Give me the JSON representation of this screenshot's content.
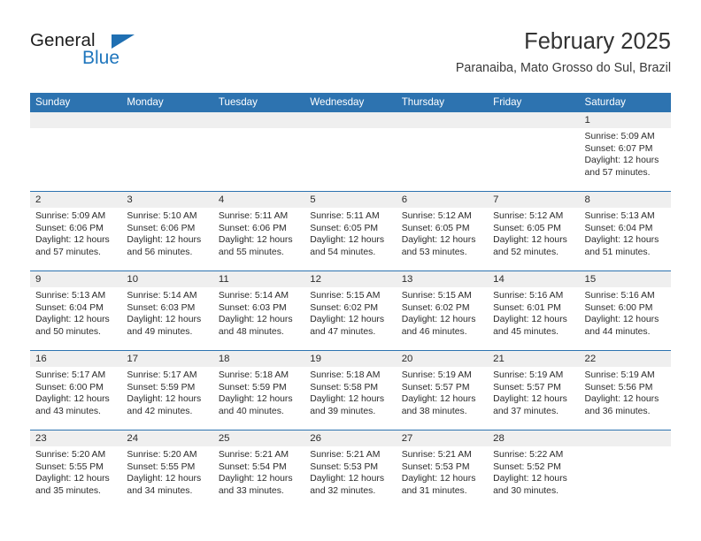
{
  "brand": {
    "name_primary": "General",
    "name_secondary": "Blue",
    "logo_icon": "triangle-icon",
    "accent_color": "#1f76bd"
  },
  "header": {
    "title": "February 2025",
    "location": "Paranaiba, Mato Grosso do Sul, Brazil"
  },
  "colors": {
    "header_blue": "#2d73b0",
    "daynum_band": "#efefef",
    "text": "#2b2b2b"
  },
  "labels": {
    "sunrise": "Sunrise:",
    "sunset": "Sunset:",
    "daylight": "Daylight:"
  },
  "weekday_headers": [
    "Sunday",
    "Monday",
    "Tuesday",
    "Wednesday",
    "Thursday",
    "Friday",
    "Saturday"
  ],
  "weeks": [
    [
      {
        "day": "",
        "lines": []
      },
      {
        "day": "",
        "lines": []
      },
      {
        "day": "",
        "lines": []
      },
      {
        "day": "",
        "lines": []
      },
      {
        "day": "",
        "lines": []
      },
      {
        "day": "",
        "lines": []
      },
      {
        "day": "1",
        "sunrise": "5:09 AM",
        "sunset": "6:07 PM",
        "daylight": "12 hours and 57 minutes.",
        "lines": [
          "Sunrise: 5:09 AM",
          "Sunset: 6:07 PM",
          "Daylight: 12 hours and 57 minutes."
        ]
      }
    ],
    [
      {
        "day": "2",
        "sunrise": "5:09 AM",
        "sunset": "6:06 PM",
        "daylight": "12 hours and 57 minutes.",
        "lines": [
          "Sunrise: 5:09 AM",
          "Sunset: 6:06 PM",
          "Daylight: 12 hours and 57 minutes."
        ]
      },
      {
        "day": "3",
        "sunrise": "5:10 AM",
        "sunset": "6:06 PM",
        "daylight": "12 hours and 56 minutes.",
        "lines": [
          "Sunrise: 5:10 AM",
          "Sunset: 6:06 PM",
          "Daylight: 12 hours and 56 minutes."
        ]
      },
      {
        "day": "4",
        "sunrise": "5:11 AM",
        "sunset": "6:06 PM",
        "daylight": "12 hours and 55 minutes.",
        "lines": [
          "Sunrise: 5:11 AM",
          "Sunset: 6:06 PM",
          "Daylight: 12 hours and 55 minutes."
        ]
      },
      {
        "day": "5",
        "sunrise": "5:11 AM",
        "sunset": "6:05 PM",
        "daylight": "12 hours and 54 minutes.",
        "lines": [
          "Sunrise: 5:11 AM",
          "Sunset: 6:05 PM",
          "Daylight: 12 hours and 54 minutes."
        ]
      },
      {
        "day": "6",
        "sunrise": "5:12 AM",
        "sunset": "6:05 PM",
        "daylight": "12 hours and 53 minutes.",
        "lines": [
          "Sunrise: 5:12 AM",
          "Sunset: 6:05 PM",
          "Daylight: 12 hours and 53 minutes."
        ]
      },
      {
        "day": "7",
        "sunrise": "5:12 AM",
        "sunset": "6:05 PM",
        "daylight": "12 hours and 52 minutes.",
        "lines": [
          "Sunrise: 5:12 AM",
          "Sunset: 6:05 PM",
          "Daylight: 12 hours and 52 minutes."
        ]
      },
      {
        "day": "8",
        "sunrise": "5:13 AM",
        "sunset": "6:04 PM",
        "daylight": "12 hours and 51 minutes.",
        "lines": [
          "Sunrise: 5:13 AM",
          "Sunset: 6:04 PM",
          "Daylight: 12 hours and 51 minutes."
        ]
      }
    ],
    [
      {
        "day": "9",
        "sunrise": "5:13 AM",
        "sunset": "6:04 PM",
        "daylight": "12 hours and 50 minutes.",
        "lines": [
          "Sunrise: 5:13 AM",
          "Sunset: 6:04 PM",
          "Daylight: 12 hours and 50 minutes."
        ]
      },
      {
        "day": "10",
        "sunrise": "5:14 AM",
        "sunset": "6:03 PM",
        "daylight": "12 hours and 49 minutes.",
        "lines": [
          "Sunrise: 5:14 AM",
          "Sunset: 6:03 PM",
          "Daylight: 12 hours and 49 minutes."
        ]
      },
      {
        "day": "11",
        "sunrise": "5:14 AM",
        "sunset": "6:03 PM",
        "daylight": "12 hours and 48 minutes.",
        "lines": [
          "Sunrise: 5:14 AM",
          "Sunset: 6:03 PM",
          "Daylight: 12 hours and 48 minutes."
        ]
      },
      {
        "day": "12",
        "sunrise": "5:15 AM",
        "sunset": "6:02 PM",
        "daylight": "12 hours and 47 minutes.",
        "lines": [
          "Sunrise: 5:15 AM",
          "Sunset: 6:02 PM",
          "Daylight: 12 hours and 47 minutes."
        ]
      },
      {
        "day": "13",
        "sunrise": "5:15 AM",
        "sunset": "6:02 PM",
        "daylight": "12 hours and 46 minutes.",
        "lines": [
          "Sunrise: 5:15 AM",
          "Sunset: 6:02 PM",
          "Daylight: 12 hours and 46 minutes."
        ]
      },
      {
        "day": "14",
        "sunrise": "5:16 AM",
        "sunset": "6:01 PM",
        "daylight": "12 hours and 45 minutes.",
        "lines": [
          "Sunrise: 5:16 AM",
          "Sunset: 6:01 PM",
          "Daylight: 12 hours and 45 minutes."
        ]
      },
      {
        "day": "15",
        "sunrise": "5:16 AM",
        "sunset": "6:00 PM",
        "daylight": "12 hours and 44 minutes.",
        "lines": [
          "Sunrise: 5:16 AM",
          "Sunset: 6:00 PM",
          "Daylight: 12 hours and 44 minutes."
        ]
      }
    ],
    [
      {
        "day": "16",
        "sunrise": "5:17 AM",
        "sunset": "6:00 PM",
        "daylight": "12 hours and 43 minutes.",
        "lines": [
          "Sunrise: 5:17 AM",
          "Sunset: 6:00 PM",
          "Daylight: 12 hours and 43 minutes."
        ]
      },
      {
        "day": "17",
        "sunrise": "5:17 AM",
        "sunset": "5:59 PM",
        "daylight": "12 hours and 42 minutes.",
        "lines": [
          "Sunrise: 5:17 AM",
          "Sunset: 5:59 PM",
          "Daylight: 12 hours and 42 minutes."
        ]
      },
      {
        "day": "18",
        "sunrise": "5:18 AM",
        "sunset": "5:59 PM",
        "daylight": "12 hours and 40 minutes.",
        "lines": [
          "Sunrise: 5:18 AM",
          "Sunset: 5:59 PM",
          "Daylight: 12 hours and 40 minutes."
        ]
      },
      {
        "day": "19",
        "sunrise": "5:18 AM",
        "sunset": "5:58 PM",
        "daylight": "12 hours and 39 minutes.",
        "lines": [
          "Sunrise: 5:18 AM",
          "Sunset: 5:58 PM",
          "Daylight: 12 hours and 39 minutes."
        ]
      },
      {
        "day": "20",
        "sunrise": "5:19 AM",
        "sunset": "5:57 PM",
        "daylight": "12 hours and 38 minutes.",
        "lines": [
          "Sunrise: 5:19 AM",
          "Sunset: 5:57 PM",
          "Daylight: 12 hours and 38 minutes."
        ]
      },
      {
        "day": "21",
        "sunrise": "5:19 AM",
        "sunset": "5:57 PM",
        "daylight": "12 hours and 37 minutes.",
        "lines": [
          "Sunrise: 5:19 AM",
          "Sunset: 5:57 PM",
          "Daylight: 12 hours and 37 minutes."
        ]
      },
      {
        "day": "22",
        "sunrise": "5:19 AM",
        "sunset": "5:56 PM",
        "daylight": "12 hours and 36 minutes.",
        "lines": [
          "Sunrise: 5:19 AM",
          "Sunset: 5:56 PM",
          "Daylight: 12 hours and 36 minutes."
        ]
      }
    ],
    [
      {
        "day": "23",
        "sunrise": "5:20 AM",
        "sunset": "5:55 PM",
        "daylight": "12 hours and 35 minutes.",
        "lines": [
          "Sunrise: 5:20 AM",
          "Sunset: 5:55 PM",
          "Daylight: 12 hours and 35 minutes."
        ]
      },
      {
        "day": "24",
        "sunrise": "5:20 AM",
        "sunset": "5:55 PM",
        "daylight": "12 hours and 34 minutes.",
        "lines": [
          "Sunrise: 5:20 AM",
          "Sunset: 5:55 PM",
          "Daylight: 12 hours and 34 minutes."
        ]
      },
      {
        "day": "25",
        "sunrise": "5:21 AM",
        "sunset": "5:54 PM",
        "daylight": "12 hours and 33 minutes.",
        "lines": [
          "Sunrise: 5:21 AM",
          "Sunset: 5:54 PM",
          "Daylight: 12 hours and 33 minutes."
        ]
      },
      {
        "day": "26",
        "sunrise": "5:21 AM",
        "sunset": "5:53 PM",
        "daylight": "12 hours and 32 minutes.",
        "lines": [
          "Sunrise: 5:21 AM",
          "Sunset: 5:53 PM",
          "Daylight: 12 hours and 32 minutes."
        ]
      },
      {
        "day": "27",
        "sunrise": "5:21 AM",
        "sunset": "5:53 PM",
        "daylight": "12 hours and 31 minutes.",
        "lines": [
          "Sunrise: 5:21 AM",
          "Sunset: 5:53 PM",
          "Daylight: 12 hours and 31 minutes."
        ]
      },
      {
        "day": "28",
        "sunrise": "5:22 AM",
        "sunset": "5:52 PM",
        "daylight": "12 hours and 30 minutes.",
        "lines": [
          "Sunrise: 5:22 AM",
          "Sunset: 5:52 PM",
          "Daylight: 12 hours and 30 minutes."
        ]
      },
      {
        "day": "",
        "lines": []
      }
    ]
  ]
}
